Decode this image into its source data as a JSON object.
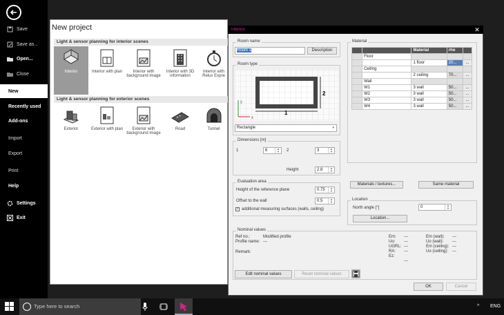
{
  "sidebar": {
    "items": [
      {
        "label": "Save",
        "icon": "save-icon"
      },
      {
        "label": "Save as...",
        "icon": "save-as-icon"
      },
      {
        "label": "Open...",
        "icon": "folder-icon"
      },
      {
        "label": "Close",
        "icon": "close-file-icon"
      },
      {
        "label": "New"
      },
      {
        "label": "Recently used"
      },
      {
        "label": "Add-ons"
      },
      {
        "label": "Import"
      },
      {
        "label": "Export"
      },
      {
        "label": "Print"
      },
      {
        "label": "Help"
      },
      {
        "label": "Settings",
        "icon": "gear-icon"
      },
      {
        "label": "Exit",
        "icon": "exit-icon"
      }
    ]
  },
  "main": {
    "title": "New project",
    "interior_section": "Light & sensor planning for interior scenes",
    "exterior_section": "Light & sensor planning for exterior scenes",
    "interior_tiles": [
      "Interior",
      "Interior with plan",
      "Interior with background image",
      "Interior with 3D information",
      "Interior with Relux Expre"
    ],
    "exterior_tiles": [
      "Exterior",
      "Exterior with plan",
      "Exterior with background image",
      "Road",
      "Tunnel"
    ]
  },
  "dialog": {
    "title": "interior",
    "room_name_label": "Room name",
    "room_name_value": "Room 1",
    "description_button": "Description",
    "room_type_label": "Room type",
    "room_type_value": "Rectangle",
    "diagram": {
      "dim1": "1",
      "dim2": "2",
      "axis_x": "x",
      "axis_y": "y"
    },
    "dimensions_label": "Dimensions [m]",
    "dim1_label": "1",
    "dim1_value": "6",
    "dim2_label": "2",
    "dim2_value": "3",
    "height_label": "Height",
    "height_value": "2.8",
    "eval_label": "Evaluation area",
    "ref_plane_label": "Height of the reference plane",
    "ref_plane_value": "0.75",
    "offset_label": "Offset to the wall",
    "offset_value": "0.5",
    "measuring_label": "additional measuring surfaces (walls, ceiling)",
    "material": {
      "label": "Material",
      "headers": [
        "Material",
        "rho"
      ],
      "rows": [
        [
          "Floor",
          "",
          ""
        ],
        [
          "",
          "1 floor",
          "20..."
        ],
        [
          "Ceiling",
          "",
          ""
        ],
        [
          "",
          "2 ceiling",
          "70..."
        ],
        [
          "Wall",
          "",
          ""
        ],
        [
          "W1",
          "3 wall",
          "50..."
        ],
        [
          "W2",
          "3 wall",
          "50..."
        ],
        [
          "W3",
          "3 wall",
          "50..."
        ],
        [
          "W4",
          "3 wall",
          "50..."
        ]
      ],
      "dots": "..."
    },
    "materials_button": "Materials / textures...",
    "same_material_button": "Same material",
    "location_label": "Location",
    "north_angle_label": "North angle [°]",
    "north_angle_value": "0",
    "location_button": "Location...",
    "nominal": {
      "label": "Nominal values",
      "ref_no_label": "Ref no.:",
      "ref_no_value": "Modified profile",
      "profile_label": "Profile name:",
      "profile_value": "---",
      "remark_label": "Remark:",
      "left_keys": [
        "Em:",
        "Uo:",
        "UGRL:",
        "RA:",
        "Ez:"
      ],
      "left_vals": [
        "---",
        "---",
        "---",
        "---",
        "---"
      ],
      "right_keys": [
        "Em (wall):",
        "Uo (wall):",
        "Em (ceiling):",
        "Uo (ceiling):"
      ],
      "right_vals": [
        "---",
        "---",
        "---",
        "---"
      ]
    },
    "edit_nominal_button": "Edit nominal values",
    "reset_nominal_button": "Reset nominal values",
    "ok_button": "OK",
    "cancel_button": "Cancel"
  },
  "taskbar": {
    "search_placeholder": "Type here to search",
    "language": "ENG"
  },
  "colors": {
    "accent": "#d2248a",
    "sidebar_bg": "#000000",
    "table_header": "#555555"
  }
}
